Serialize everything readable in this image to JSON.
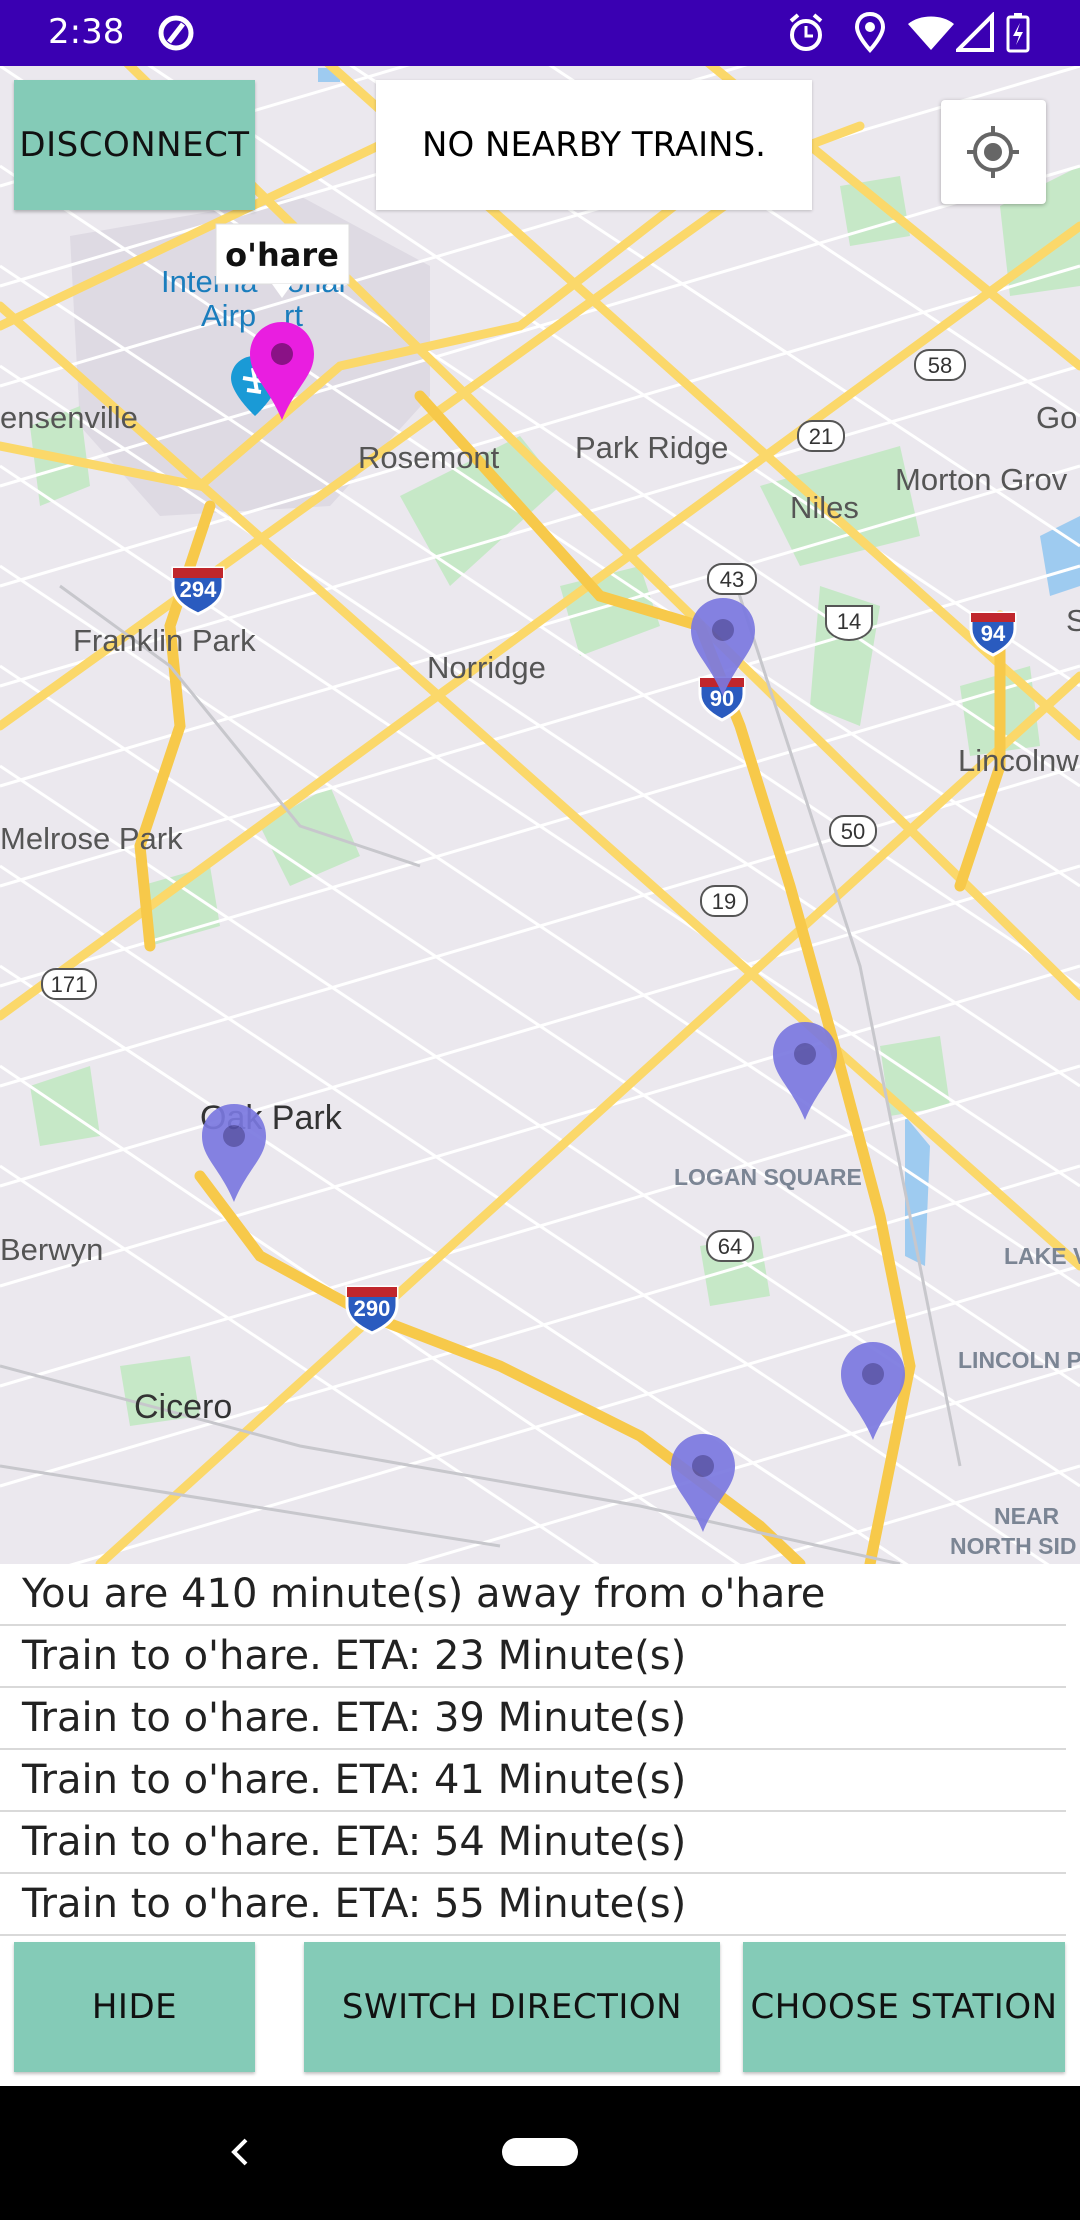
{
  "status_bar": {
    "time": "2:38"
  },
  "header": {
    "disconnect_label": "DISCONNECT",
    "info_text": "NO NEARBY TRAINS."
  },
  "map": {
    "selected_marker_label": "o'hare",
    "place_labels": [
      "Interna",
      "ional",
      "Airp",
      "rt",
      "ensenville",
      "Rosemont",
      "Park Ridge",
      "Niles",
      "Morton Grov",
      "Go",
      "Franklin Park",
      "Norridge",
      "Lincolnw",
      "S",
      "Melrose Park",
      "Oak Park",
      "LOGAN SQUARE",
      "LAKE V",
      "Berwyn",
      "Cicero",
      "LINCOLN P",
      "NEAR",
      "NORTH SID"
    ],
    "highway_shields": [
      "294",
      "43",
      "90",
      "14",
      "94",
      "58",
      "21",
      "50",
      "19",
      "171",
      "64",
      "290"
    ]
  },
  "eta_list": {
    "rows": [
      "You are 410 minute(s) away from o'hare",
      "Train to o'hare. ETA: 23 Minute(s)",
      "Train to o'hare. ETA: 39 Minute(s)",
      "Train to o'hare. ETA: 41 Minute(s)",
      "Train to o'hare. ETA: 54 Minute(s)",
      "Train to o'hare. ETA: 55 Minute(s)"
    ]
  },
  "footer": {
    "hide_label": "HIDE",
    "switch_label": "SWITCH DIRECTION",
    "choose_label": "CHOOSE STATION"
  },
  "colors": {
    "status_bar": "#3a00b2",
    "button": "#84cbb7",
    "selected_marker": "#e91ee0",
    "train_marker": "#7b78e0"
  }
}
